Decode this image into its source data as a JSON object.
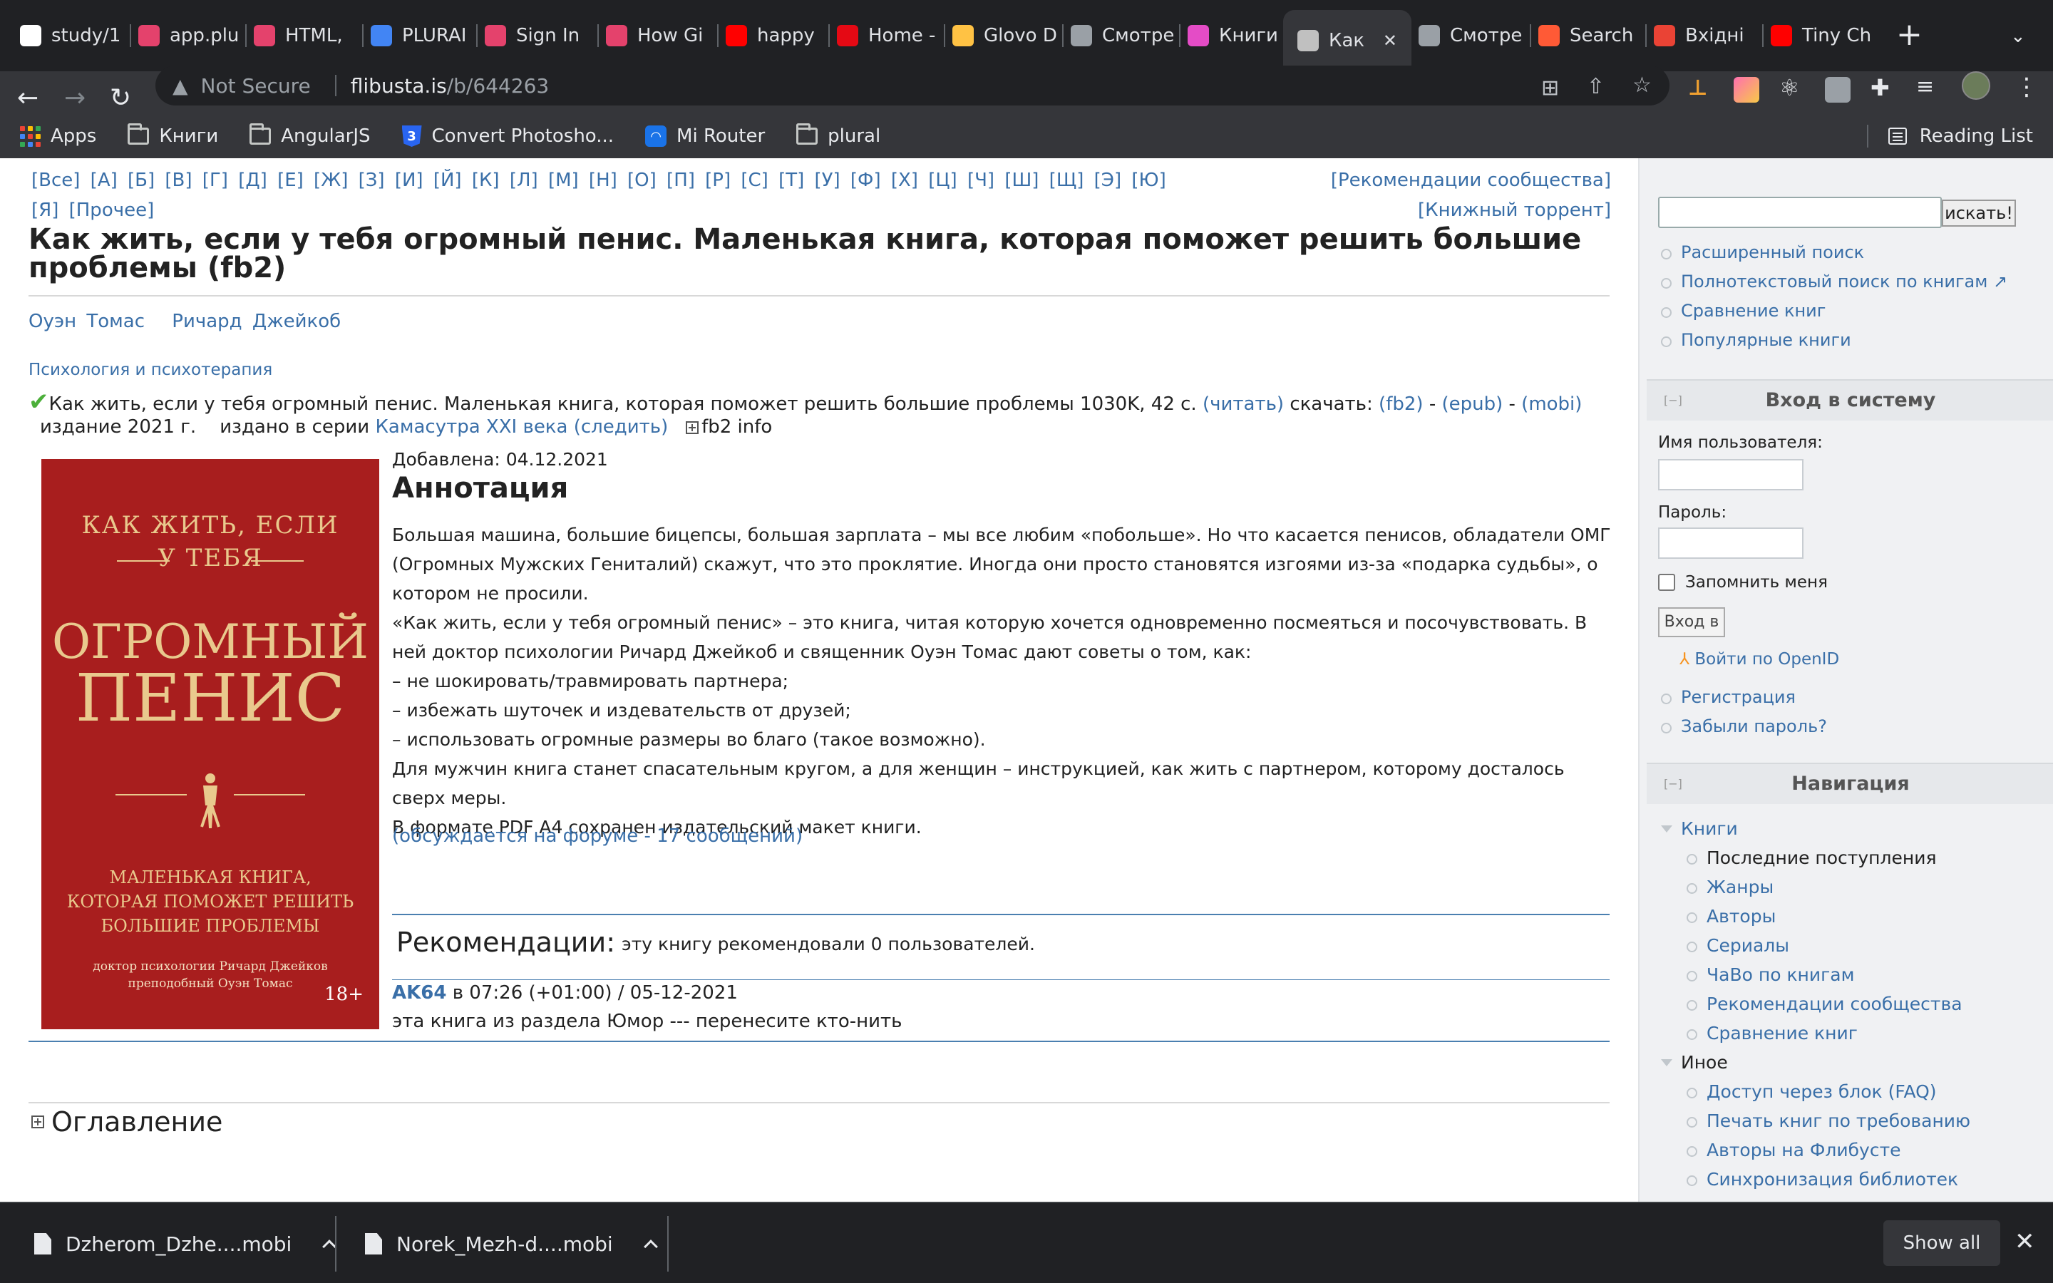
{
  "browser": {
    "tabs": [
      {
        "label": "study/1",
        "icon": "github-icon",
        "color": "#ffffff"
      },
      {
        "label": "app.plu",
        "icon": "pluralsight-icon",
        "color": "#e4426c"
      },
      {
        "label": "HTML,",
        "icon": "pluralsight-icon",
        "color": "#e4426c"
      },
      {
        "label": "PLURAI",
        "icon": "docs-icon",
        "color": "#4285f4"
      },
      {
        "label": "Sign In",
        "icon": "pluralsight-icon",
        "color": "#e4426c"
      },
      {
        "label": "How Gi",
        "icon": "pluralsight-icon",
        "color": "#e4426c"
      },
      {
        "label": "happy",
        "icon": "youtube-icon",
        "color": "#ff0000"
      },
      {
        "label": "Home -",
        "icon": "netflix-icon",
        "color": "#e50914"
      },
      {
        "label": "Glovo D",
        "icon": "glovo-icon",
        "color": "#ffc244"
      },
      {
        "label": "Смотре",
        "icon": "hd-icon",
        "color": "#9aa0a6"
      },
      {
        "label": "Книги",
        "icon": "pluralsight-icon",
        "color": "#e44cc6"
      },
      {
        "label": "Как",
        "icon": "flibusta-icon",
        "color": "#c0c0c0",
        "active": true
      },
      {
        "label": "Смотре",
        "icon": "hd-icon",
        "color": "#9aa0a6"
      },
      {
        "label": "Search",
        "icon": "search-site-icon",
        "color": "#ff5a36"
      },
      {
        "label": "Вхідні",
        "icon": "gmail-icon",
        "color": "#ea4335"
      },
      {
        "label": "Tiny Ch",
        "icon": "youtube-icon",
        "color": "#ff0000"
      }
    ],
    "address": {
      "security": "Not Secure",
      "host": "flibusta.is",
      "path": "/b/644263"
    },
    "bookmarks": [
      {
        "label": "Apps",
        "icon": "apps-grid-icon"
      },
      {
        "label": "Книги",
        "icon": "folder-icon"
      },
      {
        "label": "AngularJS",
        "icon": "folder-icon"
      },
      {
        "label": "Convert Photosho...",
        "icon": "css3-icon"
      },
      {
        "label": "Mi Router",
        "icon": "wifi-icon"
      },
      {
        "label": "plural",
        "icon": "folder-icon"
      }
    ],
    "reading_list": "Reading List"
  },
  "page": {
    "alphabet": "[Все] [А] [Б] [В] [Г] [Д] [Е] [Ж] [З] [И] [Й] [К] [Л] [М] [Н] [О] [П] [Р] [С] [Т] [У] [Ф] [Х] [Ц] [Ч] [Ш] [Щ] [Э] [Ю] [Я] [Прочее]",
    "top_link_1": "[Рекомендации сообщества]",
    "top_link_2": "[Книжный торрент]",
    "title": "Как жить, если у тебя огромный пенис. Маленькая книга, которая поможет решить большие проблемы (fb2)",
    "author_1": "Оуэн Томас",
    "author_2": "Ричард Джейкоб",
    "genre": "Психология и психотерапия",
    "book_line_text": "Как жить, если у тебя огромный пенис. Маленькая книга, которая поможет решить большие проблемы 1030K, 42 с.",
    "read_link": "(читать)",
    "download_label": "скачать:",
    "fb2_link": "(fb2)",
    "epub_link": "(epub)",
    "mobi_link": "(mobi)",
    "dash": "-",
    "edition": "издание 2021 г.",
    "series_label": "издано в серии",
    "series_link": "Камасутра XXI века (следить)",
    "fb2info": "fb2 info",
    "cover": {
      "line1": "КАК ЖИТЬ, ЕСЛИ",
      "line2": "У ТЕБЯ",
      "line3": "ОГРОМНЫЙ",
      "line4": "ПЕНИС",
      "line5": "МАЛЕНЬКАЯ КНИГА,",
      "line6": "КОТОРАЯ ПОМОЖЕТ РЕШИТЬ",
      "line7": "БОЛЬШИЕ ПРОБЛЕМЫ",
      "line8": "доктор психологии Ричард Джейков",
      "line9": "преподобный Оуэн Томас",
      "age": "18+"
    },
    "added": "Добавлена: 04.12.2021",
    "annotation_heading": "Аннотация",
    "annotation": [
      "Большая машина, большие бицепсы, большая зарплата – мы все любим «побольше». Но что касается пенисов, обладатели ОМГ (Огромных Мужских Гениталий) скажут, что это проклятие. Иногда они просто становятся изгоями из-за «подарка судьбы», о котором не просили.",
      "«Как жить, если у тебя огромный пенис» – это книга, читая которую хочется одновременно посмеяться и посочувствовать. В ней доктор психологии Ричард Джейкоб и священник Оуэн Томас дают советы о том, как:",
      "– не шокировать/травмировать партнера;",
      "– избежать шуточек и издевательств от друзей;",
      "– использовать огромные размеры во благо (такое возможно).",
      "Для мужчин книга станет спасательным кругом, а для женщин – инструкцией, как жить с партнером, которому досталось сверх меры.",
      "В формате PDF A4 сохранен издательский макет книги."
    ],
    "forum_link": "(обсуждается на форуме - 17 сообщений)",
    "recommendations_heading": "Рекомендации:",
    "recommendations_text": "эту книгу рекомендовали 0 пользователей.",
    "comment_user": "AK64",
    "comment_meta": "в 07:26 (+01:00) / 05-12-2021",
    "comment_text": "эта книга из раздела Юмор --- перенесите кто-нить",
    "toc_heading": "Оглавление"
  },
  "sidebar": {
    "search_button": "искать!",
    "search_links": [
      "Расширенный поиск",
      "Полнотекстовый поиск по книгам",
      "Сравнение книг",
      "Популярные книги"
    ],
    "collapse_marker": "[−]",
    "login_heading": "Вход в систему",
    "username_label": "Имя пользователя:",
    "password_label": "Пароль:",
    "remember_label": "Запомнить меня",
    "login_button": "Вход в с",
    "openid_link": "Войти по OpenID",
    "account_links": [
      "Регистрация",
      "Забыли пароль?"
    ],
    "nav_heading": "Навигация",
    "nav_group_1": "Книги",
    "nav_books": [
      "Последние поступления",
      "Жанры",
      "Авторы",
      "Сериалы",
      "ЧаВо по книгам",
      "Рекомендации сообщества",
      "Сравнение книг"
    ],
    "nav_group_2": "Иное",
    "nav_other": [
      "Доступ через блок (FAQ)",
      "Печать книг по требованию",
      "Авторы на Флибусте",
      "Синхронизация библиотек"
    ]
  },
  "downloads": {
    "items": [
      "Dzherom_Dzhe....mobi",
      "Norek_Mezh-d....mobi"
    ],
    "show_all": "Show all"
  }
}
